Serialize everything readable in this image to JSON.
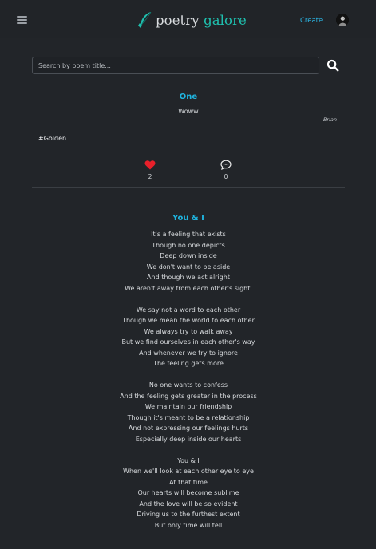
{
  "nav": {
    "brand_part1": "poetry",
    "brand_part2": "galore",
    "create_label": "Create",
    "icons": {
      "menu": "hamburger-icon",
      "logo": "quill-icon",
      "avatar": "user-avatar"
    }
  },
  "search": {
    "placeholder": "Search by poem title...",
    "icon": "search-icon"
  },
  "posts": [
    {
      "title": "One",
      "body": "Woww",
      "author_dash": "—",
      "author": "Brian",
      "tag": "#Golden",
      "likes": "2",
      "comments": "0",
      "colors": {
        "heart": "#e8202a"
      }
    },
    {
      "title": "You & I",
      "stanzas": [
        [
          "It's a feeling that exists",
          "Though no one depicts",
          "Deep down inside",
          "We don't want to be aside",
          "And though we act alright",
          "We aren't away from each other's sight."
        ],
        [
          "We say not a word to each other",
          "Though we mean the world to each other",
          "We always try to walk away",
          "But we find ourselves in each other's way",
          "And whenever we try to ignore",
          "The feeling gets more"
        ],
        [
          "No one wants to confess",
          "And the feeling gets greater in the process",
          "We maintain our friendship",
          "Though it's meant to be a relationship",
          "And not expressing our feelings hurts",
          "Especially deep inside our hearts"
        ],
        [
          "You & I",
          "When we'll look at each other eye to eye",
          "At that time",
          "Our hearts will become sublime",
          "And the love will be so evident",
          "Driving us to the furthest extent",
          "But only time will tell"
        ]
      ]
    }
  ],
  "colors": {
    "accent": "#1fb5e0",
    "brand_teal": "#1fbfae",
    "background": "#222529"
  }
}
